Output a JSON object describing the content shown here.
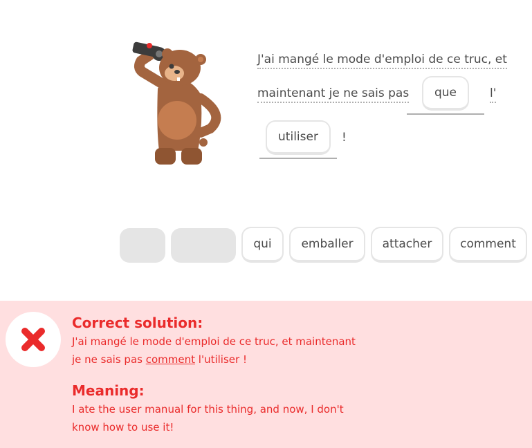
{
  "sentence": {
    "line1": "J'ai mangé le mode d'emploi de ce truc, et",
    "line2": "maintenant je ne sais pas",
    "slot1": "que",
    "after_slot1": "l'",
    "slot2": "utiliser",
    "end": "!"
  },
  "word_bank": [
    "qui",
    "emballer",
    "attacher",
    "comment"
  ],
  "feedback": {
    "solution_title": "Correct solution:",
    "solution_part1": "J'ai mangé le mode d'emploi de ce truc, et maintenant je ne sais pas",
    "solution_highlight": "comment",
    "solution_part2": "l'utiliser !",
    "meaning_title": "Meaning:",
    "meaning_text": "I ate the user manual for this thing, and now, I don't know how to use it!"
  },
  "colors": {
    "error": "#ea2b2b",
    "banner": "#ffdfe0",
    "chip_border": "#e5e5e5"
  },
  "icons": {
    "character": "bear-character",
    "status": "close-icon"
  }
}
